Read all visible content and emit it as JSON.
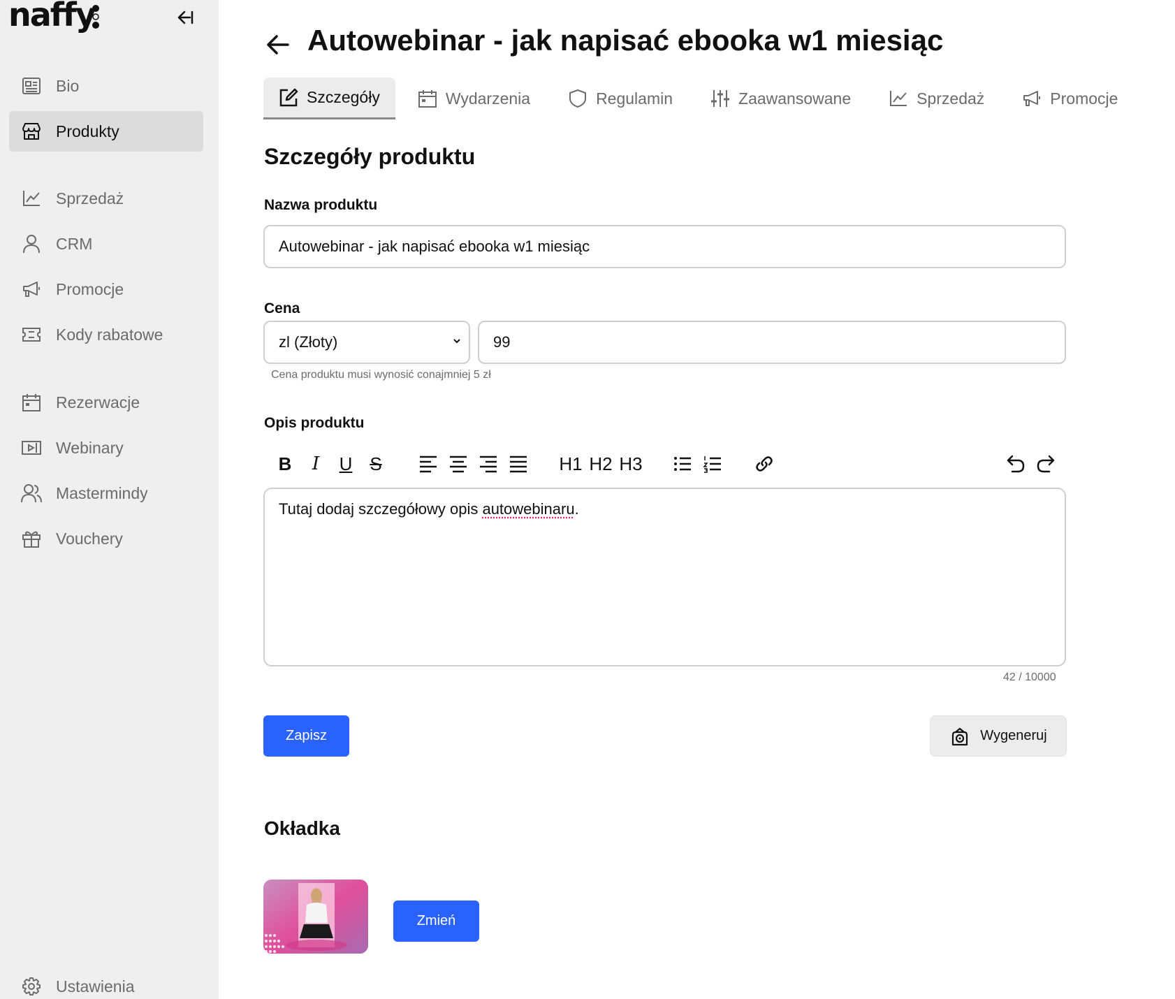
{
  "app": {
    "logo": "naffy"
  },
  "sidebar": {
    "items": [
      {
        "label": "Bio",
        "icon": "bio-icon"
      },
      {
        "label": "Produkty",
        "icon": "store-icon",
        "active": true
      },
      {
        "label": "Sprzedaż",
        "icon": "chart-line-icon"
      },
      {
        "label": "CRM",
        "icon": "user-icon"
      },
      {
        "label": "Promocje",
        "icon": "megaphone-icon"
      },
      {
        "label": "Kody rabatowe",
        "icon": "ticket-icon"
      },
      {
        "label": "Rezerwacje",
        "icon": "calendar-icon"
      },
      {
        "label": "Webinary",
        "icon": "video-icon"
      },
      {
        "label": "Mastermindy",
        "icon": "users-icon"
      },
      {
        "label": "Vouchery",
        "icon": "gift-icon"
      }
    ],
    "settings": {
      "label": "Ustawienia",
      "icon": "gear-icon"
    }
  },
  "header": {
    "title": "Autowebinar - jak napisać ebooka w1 miesiąc"
  },
  "tabs": [
    {
      "label": "Szczegóły",
      "icon": "edit-icon",
      "active": true
    },
    {
      "label": "Wydarzenia",
      "icon": "calendar-icon"
    },
    {
      "label": "Regulamin",
      "icon": "shield-icon"
    },
    {
      "label": "Zaawansowane",
      "icon": "sliders-icon"
    },
    {
      "label": "Sprzedaż",
      "icon": "chart-line-icon"
    },
    {
      "label": "Promocje",
      "icon": "megaphone-icon"
    }
  ],
  "details": {
    "heading": "Szczegóły produktu",
    "name_label": "Nazwa produktu",
    "name_value": "Autowebinar - jak napisać ebooka w1 miesiąc",
    "price_label": "Cena",
    "currency": "zl (Złoty)",
    "price_value": "99",
    "price_hint": "Cena produktu musi wynosić conajmniej 5 zł",
    "desc_label": "Opis produktu",
    "toolbar": {
      "bold": "B",
      "italic": "I",
      "underline": "U",
      "strike": "S",
      "h1": "H1",
      "h2": "H2",
      "h3": "H3"
    },
    "desc_text_before": "Tutaj dodaj szczegółowy opis ",
    "desc_text_spell": "autowebinaru",
    "desc_text_after": ".",
    "char_count": "42 / 10000",
    "save_label": "Zapisz",
    "generate_label": "Wygeneruj"
  },
  "cover": {
    "heading": "Okładka",
    "change_label": "Zmień"
  },
  "colors": {
    "primary": "#2962ff",
    "sidebar_bg": "#efefef",
    "active_bg": "#dcdcdc"
  }
}
